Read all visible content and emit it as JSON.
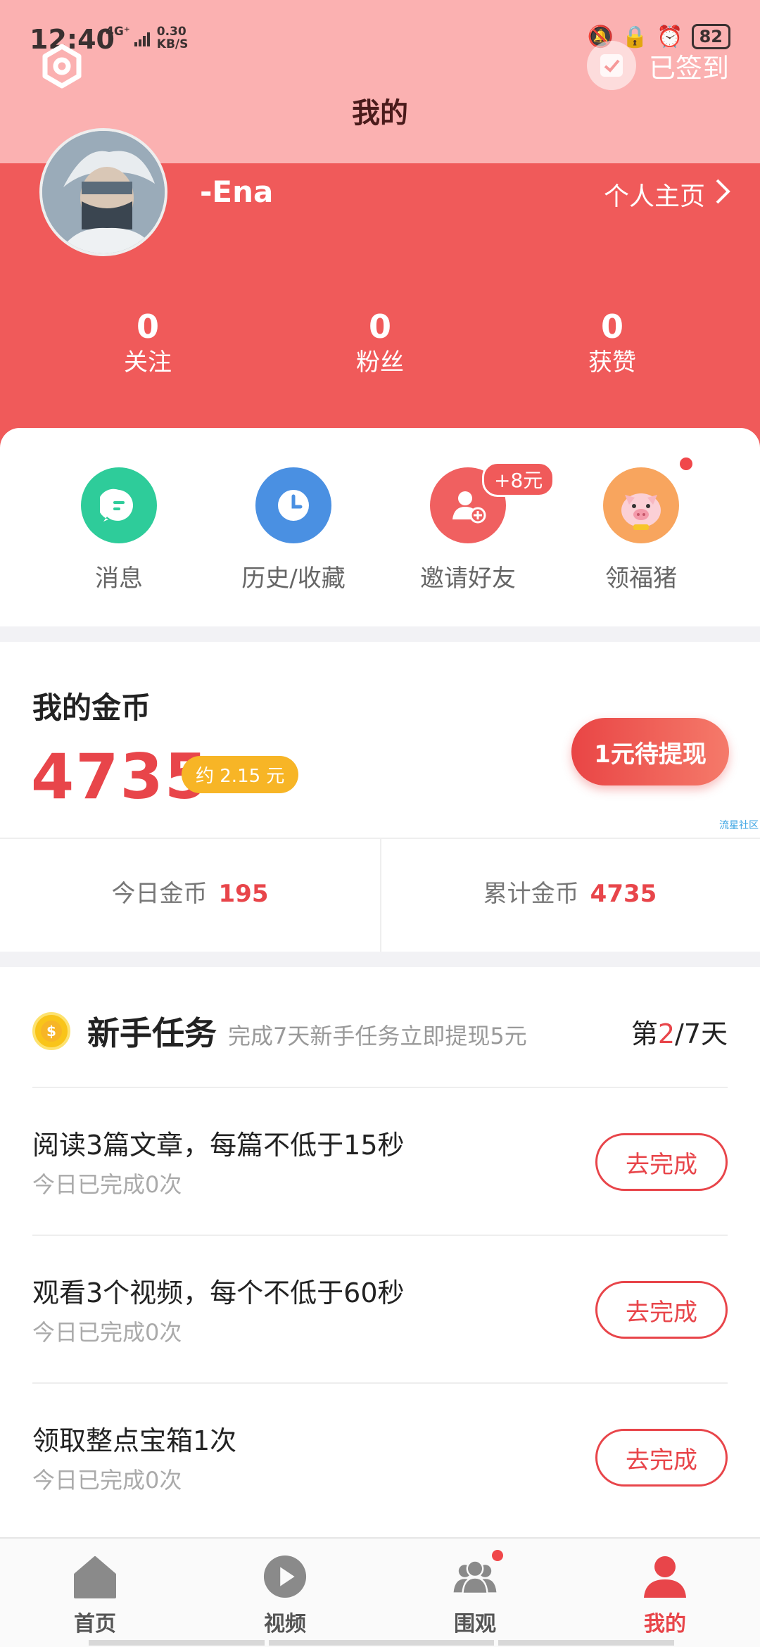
{
  "status_bar": {
    "time": "12:40",
    "network": "4G⁺",
    "speed_value": "0.30",
    "speed_unit": "KB/S",
    "battery": "82"
  },
  "header": {
    "title": "我的",
    "checkin_label": "已签到",
    "username": "-Ena",
    "homepage_label": "个人主页",
    "stats": [
      {
        "value": "0",
        "label": "关注"
      },
      {
        "value": "0",
        "label": "粉丝"
      },
      {
        "value": "0",
        "label": "获赞"
      }
    ]
  },
  "quick_actions": [
    {
      "label": "消息",
      "icon": "message-icon",
      "color": "#2ecc9a"
    },
    {
      "label": "历史/收藏",
      "icon": "clock-icon",
      "color": "#4a90e2"
    },
    {
      "label": "邀请好友",
      "icon": "invite-friend-icon",
      "color": "#f06060",
      "badge": "+8元"
    },
    {
      "label": "领福猪",
      "icon": "pig-icon",
      "color": "#f5a05a"
    }
  ],
  "coins": {
    "title": "我的金币",
    "value": "4735",
    "approx": "约 2.15 元",
    "withdraw_label": "1元待提现",
    "watermark": "流星社区",
    "today_label": "今日金币",
    "today_value": "195",
    "total_label": "累计金币",
    "total_value": "4735"
  },
  "tasks": {
    "title": "新手任务",
    "subtitle": "完成7天新手任务立即提现5元",
    "day_prefix": "第",
    "day_current": "2",
    "day_suffix": "/7天",
    "items": [
      {
        "name": "阅读3篇文章，每篇不低于15秒",
        "progress": "今日已完成0次",
        "button": "去完成"
      },
      {
        "name": "观看3个视频，每个不低于60秒",
        "progress": "今日已完成0次",
        "button": "去完成"
      },
      {
        "name": "领取整点宝箱1次",
        "progress": "今日已完成0次",
        "button": "去完成"
      }
    ]
  },
  "bottom_nav": [
    {
      "label": "首页",
      "icon": "home-icon"
    },
    {
      "label": "视频",
      "icon": "play-icon"
    },
    {
      "label": "围观",
      "icon": "group-icon"
    },
    {
      "label": "我的",
      "icon": "profile-icon",
      "active": true
    }
  ],
  "colors": {
    "accent": "#e8454a",
    "header": "#f05a5a",
    "header_top": "#fbb1b1",
    "gold": "#f7b526"
  }
}
